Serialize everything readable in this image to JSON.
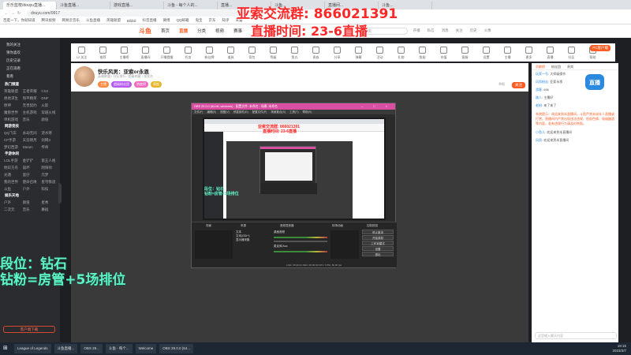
{
  "browser": {
    "tabs": [
      "乐乐蓝桉/douyu直播...",
      "斗鱼直播...",
      "游戏直播...",
      "斗鱼 - 每个人的...",
      "直播...",
      "斗鱼...",
      "直播间...",
      "斗鱼..."
    ],
    "url": "douyu.com/9917",
    "bookmarks": [
      "百度一下，你就知道",
      "腾讯视频",
      "网易云音乐",
      "斗鱼直播",
      "英雄联盟",
      "Bilibili",
      "抖音直播",
      "微博",
      "QQ邮箱",
      "淘宝",
      "京东",
      "知乎",
      "天猫"
    ]
  },
  "header": {
    "logo": "斗鱼",
    "nav": [
      "首页",
      "直播",
      "分类",
      "视频",
      "赛事"
    ],
    "active_nav": "直播",
    "search_placeholder": "搜索",
    "icons": [
      "开播",
      "私信",
      "消息",
      "关注",
      "历史",
      "头像"
    ]
  },
  "categories": [
    {
      "label": "12 关注"
    },
    {
      "label": "推荐"
    },
    {
      "label": "主播榜"
    },
    {
      "label": "直播间"
    },
    {
      "label": "开播提醒"
    },
    {
      "label": "任务"
    },
    {
      "label": "粉丝牌"
    },
    {
      "label": "道具"
    },
    {
      "label": "背包"
    },
    {
      "label": "等级"
    },
    {
      "label": "鱼丸"
    },
    {
      "label": "贵族"
    },
    {
      "label": "分享"
    },
    {
      "label": "弹幕"
    },
    {
      "label": "活动"
    },
    {
      "label": "礼物"
    },
    {
      "label": "鱼翅"
    },
    {
      "label": "充值"
    },
    {
      "label": "客服"
    },
    {
      "label": "设置"
    },
    {
      "label": "主播"
    },
    {
      "label": "更多"
    },
    {
      "label": "直播"
    },
    {
      "label": "社区"
    },
    {
      "label": "帮助"
    }
  ],
  "pc_button": "PC客户端",
  "sidebar": {
    "top_items": [
      "我的关注",
      "猜你喜欢",
      "历史记录",
      "正在观看",
      "看看"
    ],
    "section1": "热门频道",
    "grid1": [
      "英雄联盟",
      "王者荣耀",
      "CS2",
      "绝地求生",
      "和平精英",
      "DNF",
      "原神",
      "无畏契约",
      "火影",
      "魔兽世界",
      "主机游戏",
      "穿越火线",
      "单机游戏",
      "音乐",
      "颜值"
    ],
    "section2": "网游竞技",
    "grid2": [
      "QQ飞车",
      "永劫无间",
      "逆水寒",
      "CF手游",
      "天涯明月",
      "剑网3",
      "梦幻西游",
      "Steam",
      "传奇"
    ],
    "section3": "手游休闲",
    "grid3": [
      "LOL手游",
      "金铲铲",
      "第五人格",
      "明日方舟",
      "崩坏",
      "阴阳师",
      "光遇",
      "蛋仔",
      "元梦",
      "我的世界",
      "使命召唤",
      "星穹铁道",
      "斗鱼",
      "户外",
      "科技"
    ],
    "section4": "娱乐天地",
    "grid4": [
      "户外",
      "颜值",
      "星秀",
      "二次元",
      "音乐",
      "舞蹈"
    ],
    "footer_btn": "客户端下载"
  },
  "room": {
    "title": "快乐风男：亚索or永恩",
    "subtitle": "英雄联盟 / 分区排行 / 超级明星 / 领奖台",
    "badges": [
      {
        "text": "主播",
        "color": "#ff8a3d"
      },
      {
        "text": "超级粉丝团",
        "color": "#b559f0"
      },
      {
        "text": "热度榜",
        "color": "#f06ac0"
      },
      {
        "text": "贵族",
        "color": "#e8b62b"
      }
    ],
    "follow_label": "关注",
    "report_label": "举报"
  },
  "stream_overlay": {
    "line1": "亚索交流群: 866021391",
    "line2": "直播时间:  23-6直播",
    "line3a": "段位：钻石",
    "line3b": "钻粉=房管+5场排位"
  },
  "obs": {
    "title": "OBS 29.0.0 (64-bit, windows) - 配置文件: 未命名 - 场景: 未命名",
    "menu": [
      "文件(F)",
      "编辑(E)",
      "视图(V)",
      "停靠部件(D)",
      "配置文件(P)",
      "场景集合(S)",
      "工具(T)",
      "帮助(H)"
    ],
    "inner_overlay1": "亚索交流群: 866021391",
    "inner_overlay2": "直播时间:  23-6直播",
    "inner_overlay3": "段位：钻石",
    "inner_overlay4": "钻粉=房管+5场排位",
    "panels": [
      "场景",
      "来源",
      "音频混音器",
      "转场动画",
      "控制按钮"
    ],
    "sources": [
      "文本",
      "文本(GDI+)",
      "显示器采集"
    ],
    "mixer": [
      "桌面音频",
      "麦克风/Aux"
    ],
    "controls": [
      "停止推流",
      "开始录制",
      "工作室模式",
      "设置",
      "退出"
    ],
    "status": "LIVE: 00:43:21   REC: 00:00:00   CPU: 9.8%, 60.00 fps"
  },
  "chat": {
    "tabs": [
      "贡献榜",
      "粉丝团",
      "贵宾"
    ],
    "active_tab": "贡献榜",
    "lines": [
      {
        "nick": "玩家一号",
        "text": "大师级操作"
      },
      {
        "nick": "风男粉丝",
        "text": "亚索永恩"
      },
      {
        "nick": "游客",
        "text": "666"
      },
      {
        "nick": "路人",
        "text": "主播好"
      },
      {
        "nick": "老粉",
        "text": "来了来了"
      }
    ],
    "system_msg": "系统提示：欢迎来到本直播间，斗鱼严禁未成年人直播或打赏。直播间内严禁出现违法违规、低俗色情、吸烟酗酒等内容，若有违规行为请及时举报。",
    "user_msgs": [
      {
        "nick": "小鱼儿",
        "text": "欢迎来到本直播间"
      },
      {
        "nick": "风男",
        "text": "欢迎来到本直播间"
      }
    ],
    "input_placeholder": "这里输入聊天内容",
    "floating_btn": "直播"
  },
  "taskbar": {
    "items": [
      "League of Legends",
      "斗鱼直播...",
      "OBS 29...",
      "斗鱼 - 每个...",
      "Welcome",
      "OBS 29.0.0 (64..."
    ],
    "time": "19:15",
    "date": "2023/3/7"
  },
  "colors": {
    "brand": "#ff5d23",
    "overlay_red": "#ff2828",
    "overlay_teal": "#5ef2c7",
    "obs_title": "#d94fa1"
  }
}
